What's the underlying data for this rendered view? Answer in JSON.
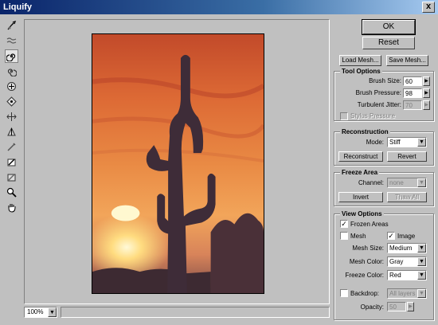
{
  "window": {
    "title": "Liquify",
    "close_glyph": "x"
  },
  "tools": [
    {
      "name": "warp-tool-icon"
    },
    {
      "name": "turbulence-tool-icon"
    },
    {
      "name": "twirl-clockwise-tool-icon"
    },
    {
      "name": "twirl-counterclockwise-tool-icon"
    },
    {
      "name": "pucker-tool-icon"
    },
    {
      "name": "bloat-tool-icon"
    },
    {
      "name": "shift-pixels-tool-icon"
    },
    {
      "name": "reflection-tool-icon"
    },
    {
      "name": "reconstruct-tool-icon"
    },
    {
      "name": "freeze-tool-icon"
    },
    {
      "name": "thaw-tool-icon"
    },
    {
      "name": "zoom-tool-icon"
    },
    {
      "name": "hand-tool-icon"
    }
  ],
  "zoom": {
    "value": "100%"
  },
  "buttons": {
    "ok": "OK",
    "reset": "Reset",
    "load_mesh": "Load Mesh...",
    "save_mesh": "Save Mesh..."
  },
  "tool_options": {
    "title": "Tool Options",
    "brush_size_label": "Brush Size:",
    "brush_size": "60",
    "brush_pressure_label": "Brush Pressure:",
    "brush_pressure": "98",
    "turbulent_jitter_label": "Turbulent Jitter:",
    "turbulent_jitter": "70",
    "stylus_pressure_label": "Stylus Pressure"
  },
  "reconstruction": {
    "title": "Reconstruction",
    "mode_label": "Mode:",
    "mode": "Stiff",
    "reconstruct": "Reconstruct",
    "revert": "Revert"
  },
  "freeze_area": {
    "title": "Freeze Area",
    "channel_label": "Channel:",
    "channel": "none",
    "invert": "Invert",
    "thaw_all": "Thaw All"
  },
  "view_options": {
    "title": "View Options",
    "frozen_areas": "Frozen Areas",
    "mesh": "Mesh",
    "image": "Image",
    "mesh_size_label": "Mesh Size:",
    "mesh_size": "Medium",
    "mesh_color_label": "Mesh Color:",
    "mesh_color": "Gray",
    "freeze_color_label": "Freeze Color:",
    "freeze_color": "Red",
    "backdrop": "Backdrop:",
    "backdrop_layer": "All layers",
    "opacity_label": "Opacity:",
    "opacity": "50"
  },
  "colors": {
    "title_bar_start": "#0a246a",
    "title_bar_end": "#a6caf0",
    "dialog_bg": "#c0c0c0"
  }
}
